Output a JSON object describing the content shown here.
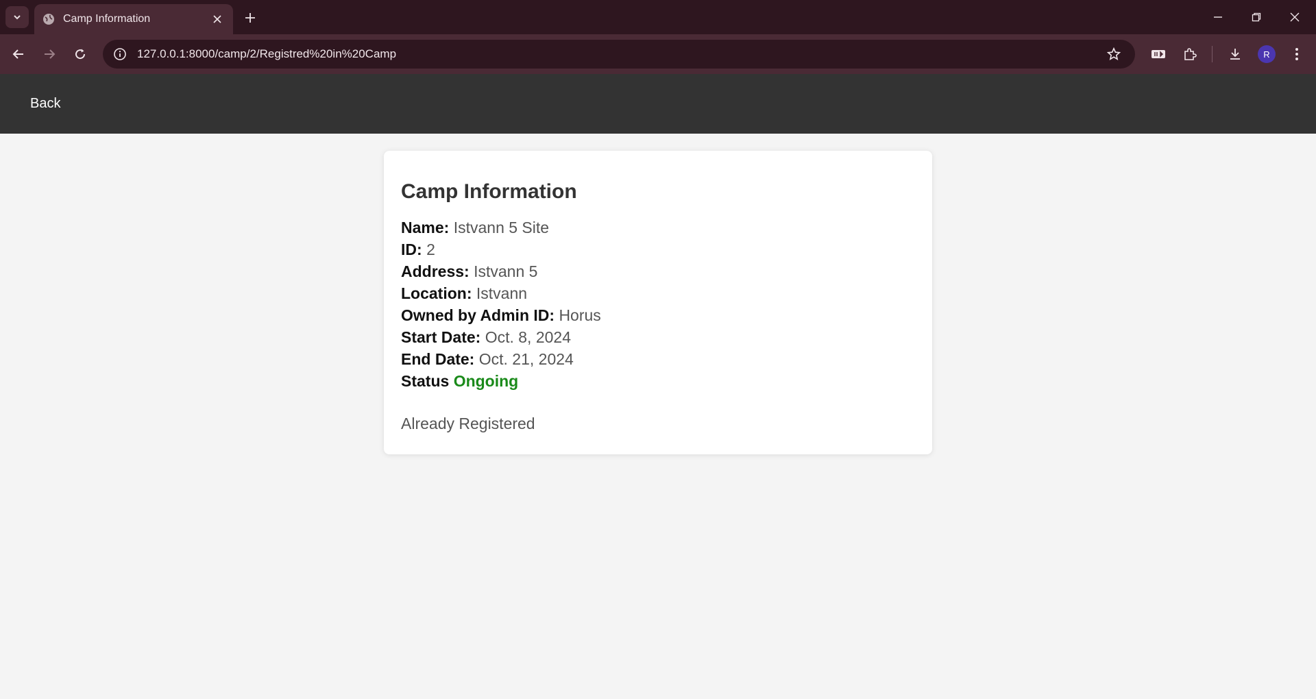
{
  "browser": {
    "tab_title": "Camp Information",
    "url": "127.0.0.1:8000/camp/2/Registred%20in%20Camp",
    "profile_initial": "R"
  },
  "navbar": {
    "back_label": "Back"
  },
  "camp": {
    "heading": "Camp Information",
    "fields": [
      {
        "label": "Name:",
        "value": "Istvann 5 Site"
      },
      {
        "label": "ID:",
        "value": "2"
      },
      {
        "label": "Address:",
        "value": "Istvann 5"
      },
      {
        "label": "Location:",
        "value": "Istvann"
      },
      {
        "label": "Owned by Admin ID:",
        "value": "Horus"
      },
      {
        "label": "Start Date:",
        "value": "Oct. 8, 2024"
      },
      {
        "label": "End Date:",
        "value": "Oct. 21, 2024"
      }
    ],
    "status_label": "Status",
    "status_value": "Ongoing",
    "status_color": "#1a8a1a",
    "registration_text": "Already Registered"
  }
}
